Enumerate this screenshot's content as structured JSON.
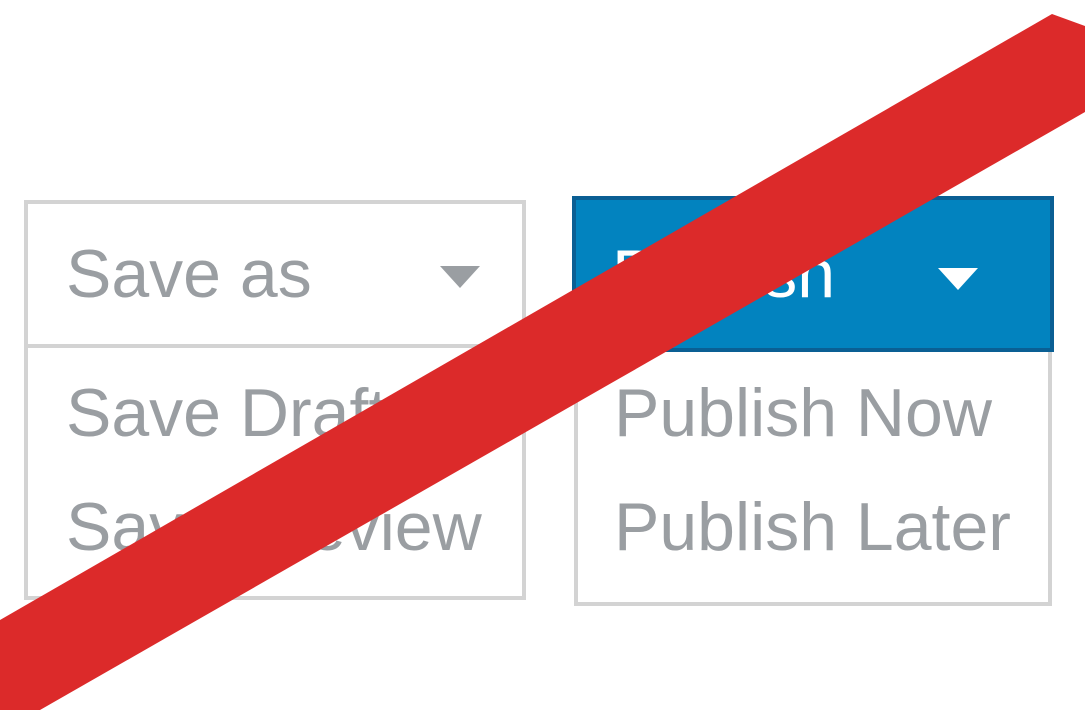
{
  "save_dropdown": {
    "button_label": "Save as",
    "icon": "caret-down-icon",
    "items": [
      "Save Draft",
      "Save Preview"
    ]
  },
  "publish_dropdown": {
    "button_label": "Publish",
    "icon": "caret-down-icon",
    "items": [
      "Publish Now",
      "Publish Later"
    ]
  },
  "overlay": {
    "icon": "red-slash-icon"
  },
  "colors": {
    "publish_primary": "#0283bf",
    "publish_border": "#0a5f94",
    "neutral_border": "#d3d3d3",
    "neutral_text": "#9a9ea2",
    "slash_red": "#dc2a2a"
  }
}
